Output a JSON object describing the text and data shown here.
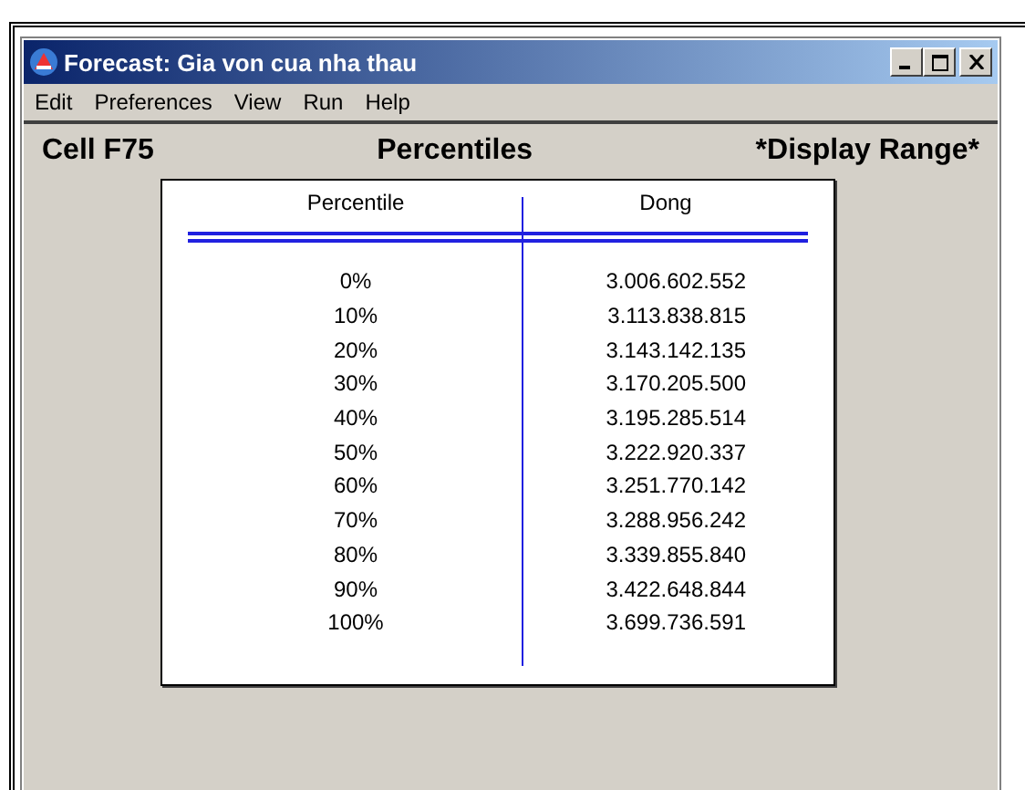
{
  "window": {
    "title": "Forecast: Gia von cua nha thau"
  },
  "menu": [
    "Edit",
    "Preferences",
    "View",
    "Run",
    "Help"
  ],
  "header": {
    "cell": "Cell F75",
    "title": "Percentiles",
    "range": "*Display Range*"
  },
  "table": {
    "columns": [
      "Percentile",
      "Dong"
    ],
    "rows": [
      [
        "0%",
        "3.006.602.552"
      ],
      [
        "10%",
        "3.113.838.815"
      ],
      [
        "20%",
        "3.143.142.135"
      ],
      [
        "30%",
        "3.170.205.500"
      ],
      [
        "40%",
        "3.195.285.514"
      ],
      [
        "50%",
        "3.222.920.337"
      ],
      [
        "60%",
        "3.251.770.142"
      ],
      [
        "70%",
        "3.288.956.242"
      ],
      [
        "80%",
        "3.339.855.840"
      ],
      [
        "90%",
        "3.422.648.844"
      ],
      [
        "100%",
        "3.699.736.591"
      ]
    ]
  }
}
